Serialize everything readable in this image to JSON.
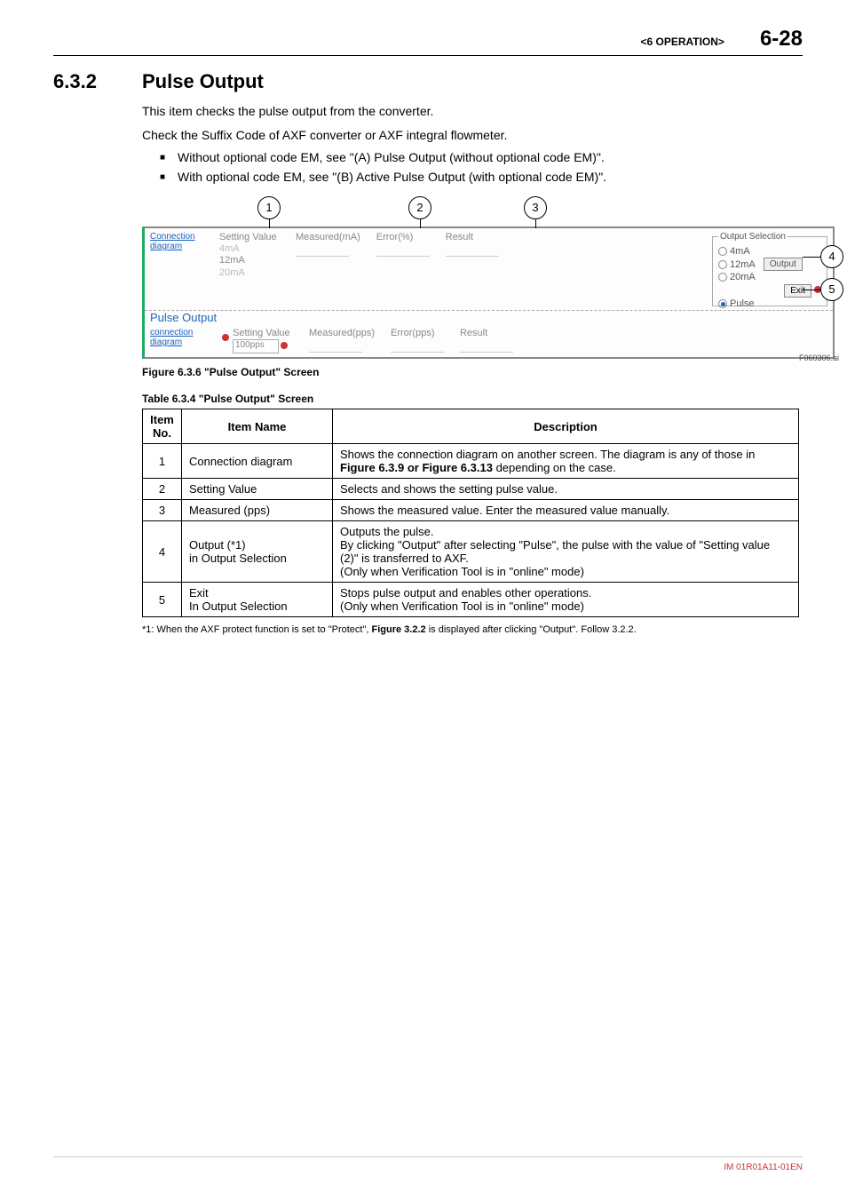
{
  "header": {
    "chapter": "<6  OPERATION>",
    "page": "6-28"
  },
  "section": {
    "number": "6.3.2",
    "title": "Pulse Output"
  },
  "intro": {
    "p1": "This item checks the pulse output from the converter.",
    "p2": "Check the Suffix Code of AXF converter or AXF integral flowmeter.",
    "b1": "Without optional code EM, see \"(A) Pulse Output (without optional code EM)\".",
    "b2": "With optional code EM, see \"(B) Active Pulse Output (with optional code EM)\"."
  },
  "callouts": {
    "c1": "1",
    "c2": "2",
    "c3": "3",
    "c4": "4",
    "c5": "5"
  },
  "shot": {
    "top": {
      "conn": "Connection diagram",
      "sv_label": "Setting Value",
      "sv_4": "4mA",
      "sv_12": "12mA",
      "sv_20": "20mA",
      "meas": "Measured(mA)",
      "err": "Error(%)",
      "res": "Result"
    },
    "pulse_label": "Pulse Output",
    "bot": {
      "conn": "connection diagram",
      "sv_label": "Setting Value",
      "sv_val": "100pps",
      "meas": "Measured(pps)",
      "err": "Error(pps)",
      "res": "Result"
    },
    "outsel": {
      "legend": "Output Selection",
      "o4": "4mA",
      "o12": "12mA",
      "o20": "20mA",
      "output_btn": "Output",
      "exit_btn": "Exit",
      "pulse": "Pulse"
    },
    "figref": "F060306.ai"
  },
  "figcap": "Figure 6.3.6 \"Pulse Output\" Screen",
  "tabcap": "Table 6.3.4 \"Pulse Output\" Screen",
  "table": {
    "h1": "Item No.",
    "h2": "Item Name",
    "h3": "Description",
    "rows": [
      {
        "no": "1",
        "name": "Connection diagram",
        "desc": "Shows the connection diagram on another screen. The diagram is any of those in Figure 6.3.9 or Figure 6.3.13 depending on the case.",
        "bold": "Figure 6.3.9 or Figure 6.3.13"
      },
      {
        "no": "2",
        "name": "Setting Value",
        "desc": "Selects and shows the setting pulse value."
      },
      {
        "no": "3",
        "name": "Measured (pps)",
        "desc": "Shows the measured value. Enter the measured value manually."
      },
      {
        "no": "4",
        "name": "Output (*1)\nin Output Selection",
        "desc": "Outputs the pulse.\nBy clicking \"Output\" after selecting \"Pulse\", the pulse with the value of \"Setting value (2)\" is transferred to AXF.\n(Only when Verification Tool is in \"online\" mode)"
      },
      {
        "no": "5",
        "name": "Exit\nIn Output Selection",
        "desc": "Stops pulse output and enables other operations.\n(Only when Verification Tool is in \"online\" mode)"
      }
    ]
  },
  "footnote": {
    "pre": "*1: When the AXF protect function is set to \"Protect\", ",
    "bold": "Figure 3.2.2",
    "post": " is displayed after clicking \"Output\". Follow 3.2.2."
  },
  "footer": "IM 01R01A11-01EN"
}
